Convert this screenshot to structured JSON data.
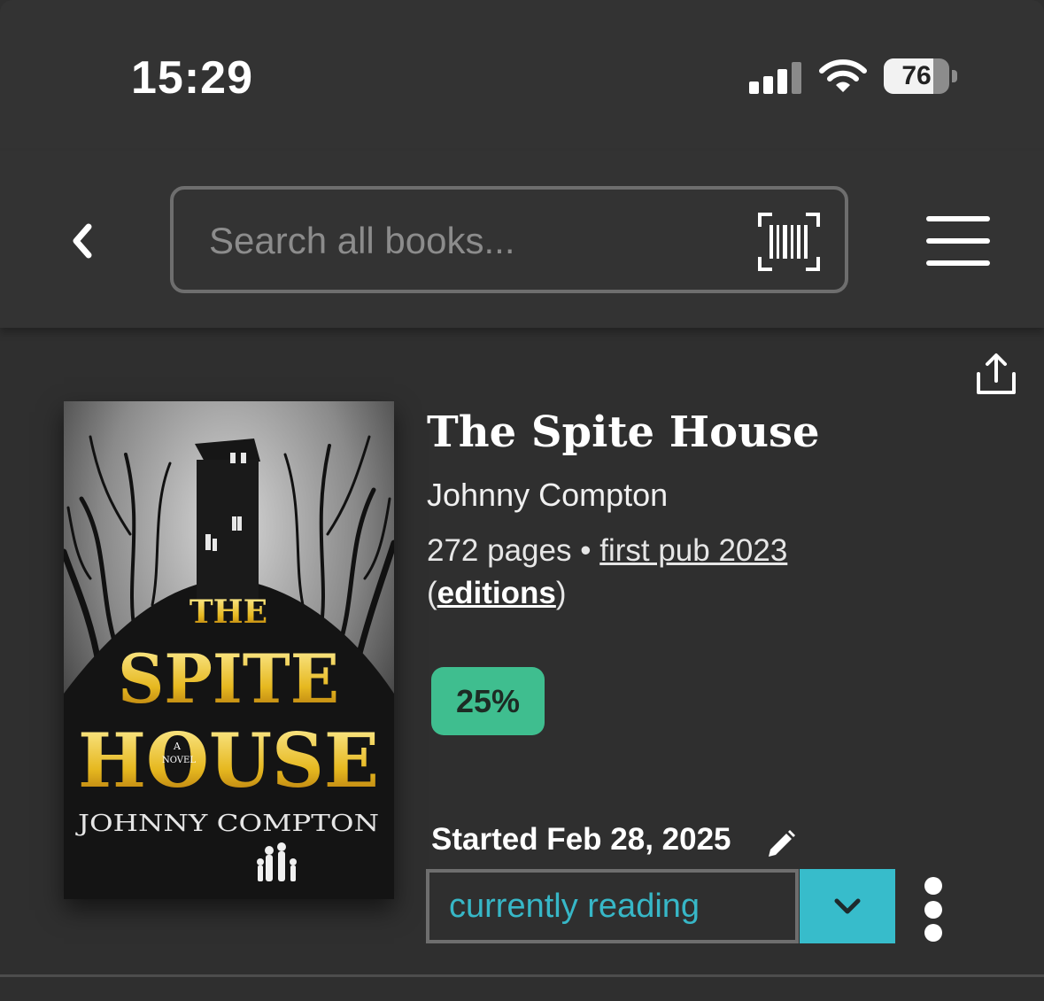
{
  "status_bar": {
    "time": "15:29",
    "battery": "76",
    "battery_level": 0.76
  },
  "header": {
    "search_placeholder": "Search all books...",
    "icons": [
      "chevron-left-icon",
      "barcode-scan-icon",
      "hamburger-menu-icon"
    ]
  },
  "book": {
    "title": "The Spite House",
    "author": "Johnny Compton",
    "pages": "272 pages",
    "separator": "•",
    "first_pub": "first pub 2023",
    "editions_open": "(",
    "editions": "editions",
    "editions_close": ")",
    "cover": {
      "line1": "THE",
      "line2": "SPITE",
      "line3": "HOUSE",
      "tag_a": "A",
      "tag_novel": "NOVEL",
      "author": "JOHNNY COMPTON"
    }
  },
  "reading": {
    "progress": "25%",
    "started": "Started Feb 28, 2025",
    "status": "currently reading"
  },
  "colors": {
    "background": "#2f2f2f",
    "progress_badge": "#3fbe8f",
    "status_accent": "#37bccb"
  }
}
